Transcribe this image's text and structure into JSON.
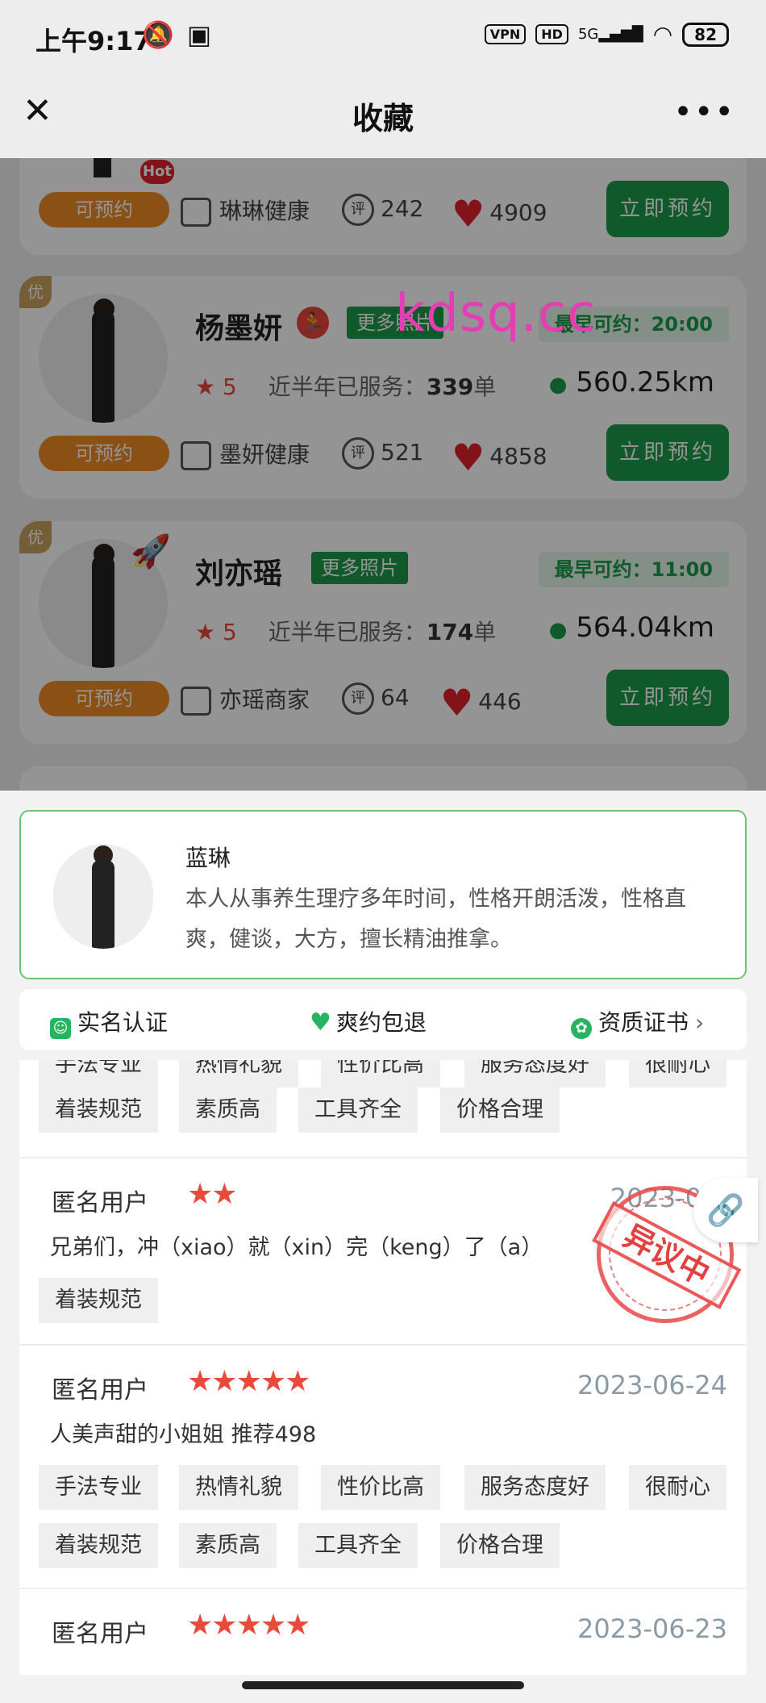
{
  "status_bar": {
    "time": "上午9:17",
    "vpn": "VPN",
    "hd": "HD",
    "network": "5G",
    "battery": "82"
  },
  "title_bar": {
    "title": "收藏"
  },
  "watermark": "kdsq.cc",
  "list": {
    "cards": [
      {
        "hot": "Hot",
        "bookable": "可预约",
        "shop": "琳琳健康",
        "review_icon": "评",
        "reviews": "242",
        "likes": "4909",
        "book_now": "立即预约"
      },
      {
        "badge": "优",
        "name": "杨墨妍",
        "more_photos": "更多照片",
        "earliest": "最早可约：20:00",
        "score": "5",
        "served_prefix": "近半年已服务：",
        "served_count": "339",
        "served_unit": "单",
        "distance": "560.25km",
        "bookable": "可预约",
        "shop": "墨妍健康",
        "review_icon": "评",
        "reviews": "521",
        "likes": "4858",
        "book_now": "立即预约"
      },
      {
        "badge": "优",
        "name": "刘亦瑶",
        "more_photos": "更多照片",
        "earliest": "最早可约：11:00",
        "score": "5",
        "served_prefix": "近半年已服务：",
        "served_count": "174",
        "served_unit": "单",
        "distance": "564.04km",
        "bookable": "可预约",
        "shop": "亦瑶商家",
        "review_icon": "评",
        "reviews": "64",
        "likes": "446",
        "book_now": "立即预约"
      }
    ]
  },
  "profile": {
    "name": "蓝琳",
    "description": "本人从事养生理疗多年时间，性格开朗活泼，性格直爽，健谈，大方，擅长精油推拿。"
  },
  "features": {
    "real_name": "实名认证",
    "refund": "爽约包退",
    "certificate": "资质证书"
  },
  "tags_top": [
    "手法专业",
    "热情礼貌",
    "性价比高",
    "服务态度好",
    "很耐心",
    "着装规范",
    "素质高",
    "工具齐全",
    "价格合理"
  ],
  "reviews": [
    {
      "user": "匿名用户",
      "stars": 2,
      "date": "2023-06-",
      "content": "兄弟们，冲（xiao）就（xin）完（keng）了（a）",
      "tags": [
        "着装规范"
      ]
    },
    {
      "user": "匿名用户",
      "stars": 5,
      "date": "2023-06-24",
      "content": "人美声甜的小姐姐 推荐498",
      "tags": [
        "手法专业",
        "热情礼貌",
        "性价比高",
        "服务态度好",
        "很耐心",
        "着装规范",
        "素质高",
        "工具齐全",
        "价格合理"
      ]
    },
    {
      "user": "匿名用户",
      "stars": 5,
      "date": "2023-06-23"
    }
  ],
  "stamp": "异议中",
  "colors": {
    "green": "#1b9a4a",
    "orange": "#f08a24",
    "red": "#e84a3c",
    "profile_border": "#6cc46f"
  }
}
